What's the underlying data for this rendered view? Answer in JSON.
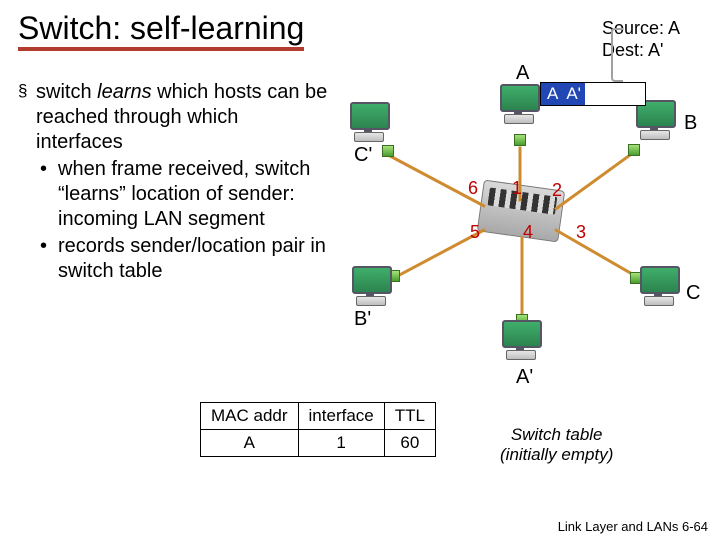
{
  "title": "Switch: self-learning",
  "subtitle": {
    "line1": "Source: A",
    "line2": "Dest: A'"
  },
  "bullets": {
    "l1_prefix": "switch ",
    "l1_italic": "learns",
    "l1_suffix": " which hosts can be reached through which interfaces",
    "l2a": "when frame received, switch “learns” location of sender: incoming LAN segment",
    "l2b": "records sender/location pair in switch table"
  },
  "diagram": {
    "hosts": {
      "A": "A",
      "B": "B",
      "C": "C",
      "Aprime": "A'",
      "Bprime": "B'",
      "Cprime": "C'"
    },
    "ports": {
      "p1": "1",
      "p2": "2",
      "p3": "3",
      "p4": "4",
      "p5": "5",
      "p6": "6"
    },
    "frame": {
      "src": "A",
      "dst": "A'"
    }
  },
  "table": {
    "headers": {
      "mac": "MAC addr",
      "iface": "interface",
      "ttl": "TTL"
    },
    "rows": [
      {
        "mac": "A",
        "iface": "1",
        "ttl": "60"
      }
    ],
    "caption_line1": "Switch table",
    "caption_line2": "(initially empty)"
  },
  "footer": "Link Layer and LANs   6-64"
}
